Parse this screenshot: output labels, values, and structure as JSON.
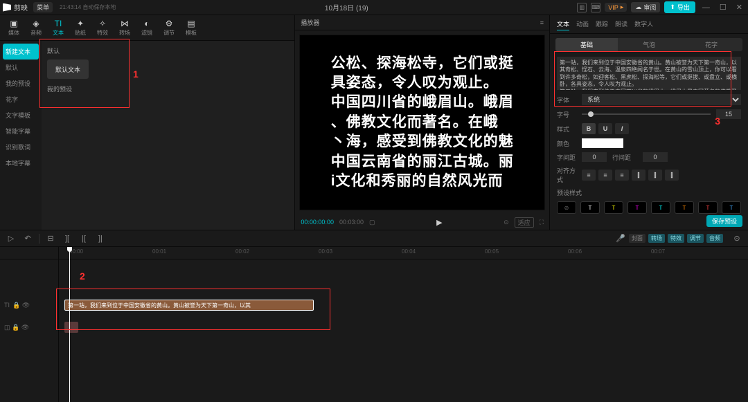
{
  "titlebar": {
    "logo": "剪映",
    "menu": "菜单",
    "autosave": "21:43:14 自动保存本地",
    "title_center": "10月18日 (19)",
    "vip": "VIP",
    "review": "审阅",
    "export": "导出"
  },
  "tools": [
    "媒体",
    "音频",
    "文本",
    "贴纸",
    "特效",
    "转场",
    "滤镜",
    "调节",
    "模板"
  ],
  "sidebar": [
    "新建文本",
    "默认",
    "我的预设",
    "花字",
    "文字模板",
    "智能字幕",
    "识别歌词",
    "本地字幕"
  ],
  "content": {
    "section": "默认",
    "preset": "默认文本",
    "my": "我的预设"
  },
  "player": {
    "header": "播放器",
    "text": "公松、探海松寺，它们或挺\n具姿态，令人叹为观止。\n中国四川省的峨眉山。峨眉\n、佛教文化而著名。在峨\n丶海，感受到佛教文化的魅\n中国云南省的丽江古城。丽\ni文化和秀丽的自然风光而",
    "t1": "00:00:00:00",
    "t2": "00:03:00",
    "ratio": "适应"
  },
  "rp": {
    "tabs": [
      "文本",
      "动画",
      "跟踪",
      "朗读",
      "数字人"
    ],
    "subtabs": [
      "基础",
      "气泡",
      "花字"
    ],
    "textarea": "第一站，我们来到位于中国安徽省的黄山。黄山被誉为天下第一奇山，以其奇松、怪石、云海、温泉四绝闻名于世。在黄山的雪山顶上，你可以看到许多奇松，如迎客松、黑虎松、探海松等，它们或挺拔、或盘立、或横卧，各具姿态，令人叹为观止。\n第二站，我们来到位于中国四川省的峨眉山。峨眉山是中国著名的佛教圣地",
    "font_label": "字体",
    "font_value": "系统",
    "size_label": "字号",
    "size_value": "15",
    "style_label": "样式",
    "color_label": "颜色",
    "spacing_label": "字间距",
    "spacing_value": "0",
    "line_label": "行间距",
    "line_value": "0",
    "align_label": "对齐方式",
    "preset_label": "预设样式",
    "save": "保存预设"
  },
  "annot": {
    "l1": "1",
    "l2": "2",
    "l3": "3"
  },
  "timeline": {
    "chips": [
      "封面",
      "转场",
      "特效",
      "调节",
      "音频"
    ],
    "ticks": [
      "00:00",
      "00:01",
      "00:02",
      "00:03",
      "00:04",
      "00:05",
      "00:06",
      "00:07"
    ],
    "clip_text": "第一站，我们来到位于中国安徽省的黄山。黄山被誉为天下第一奇山，以其",
    "track1": "TI",
    "track2": ""
  }
}
